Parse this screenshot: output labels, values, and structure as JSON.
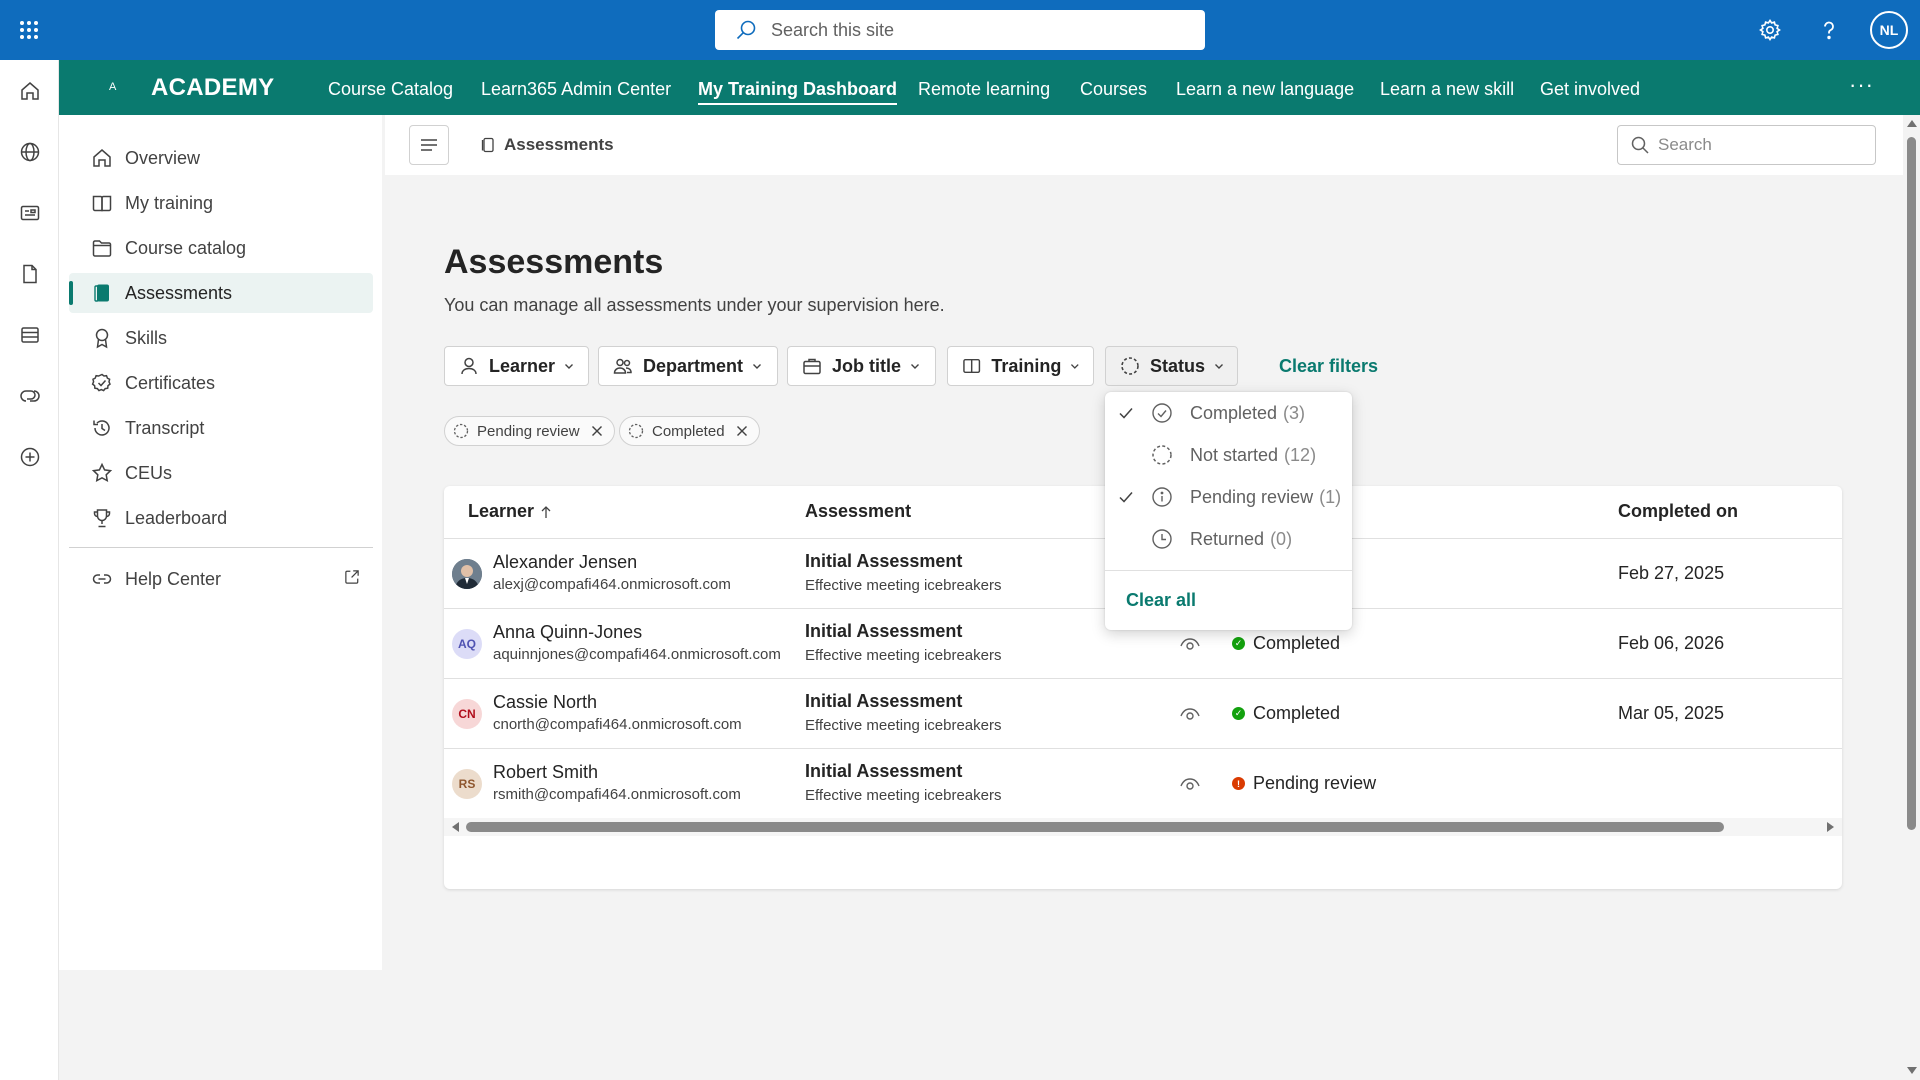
{
  "suite": {
    "search_placeholder": "Search this site",
    "user_initials": "NL"
  },
  "hub": {
    "logo_text": "A",
    "title": "ACADEMY",
    "items": [
      {
        "label": "Course Catalog"
      },
      {
        "label": "Learn365 Admin Center"
      },
      {
        "label": "My Training Dashboard",
        "active": true
      },
      {
        "label": "Remote learning"
      },
      {
        "label": "Courses"
      },
      {
        "label": "Learn a new language"
      },
      {
        "label": "Learn a new skill"
      },
      {
        "label": "Get involved"
      }
    ],
    "more_label": "···"
  },
  "leftnav": {
    "items": [
      {
        "label": "Overview",
        "icon": "home-icon"
      },
      {
        "label": "My training",
        "icon": "book-icon"
      },
      {
        "label": "Course catalog",
        "icon": "folder-icon"
      },
      {
        "label": "Assessments",
        "icon": "notebook-icon",
        "selected": true
      },
      {
        "label": "Skills",
        "icon": "ribbon-icon"
      },
      {
        "label": "Certificates",
        "icon": "certificate-icon"
      },
      {
        "label": "Transcript",
        "icon": "history-icon"
      },
      {
        "label": "CEUs",
        "icon": "star-icon"
      },
      {
        "label": "Leaderboard",
        "icon": "trophy-icon"
      }
    ],
    "help": {
      "label": "Help Center",
      "icon": "link-icon"
    }
  },
  "cmdbar": {
    "breadcrumb": "Assessments",
    "search_placeholder": "Search"
  },
  "page": {
    "title": "Assessments",
    "subtitle": "You can manage all assessments under your supervision here."
  },
  "filters": {
    "buttons": [
      {
        "label": "Learner",
        "icon": "person-icon"
      },
      {
        "label": "Department",
        "icon": "people-icon"
      },
      {
        "label": "Job title",
        "icon": "briefcase-icon"
      },
      {
        "label": "Training",
        "icon": "book-icon"
      },
      {
        "label": "Status",
        "icon": "status-circle-icon"
      }
    ],
    "clear_label": "Clear filters",
    "chips": [
      {
        "label": "Pending review"
      },
      {
        "label": "Completed"
      }
    ]
  },
  "table": {
    "columns": [
      "Learner",
      "Assessment",
      "Completed on"
    ],
    "rows": [
      {
        "initials": "",
        "name": "Alexander Jensen",
        "email": "alexj@compafi464.onmicrosoft.com",
        "assessment": "Initial Assessment",
        "course": "Effective meeting icebreakers",
        "status": "",
        "completed_on": "Feb 27, 2025"
      },
      {
        "initials": "AQ",
        "name": "Anna Quinn-Jones",
        "email": "aquinnjones@compafi464.onmicrosoft.com",
        "assessment": "Initial Assessment",
        "course": "Effective meeting icebreakers",
        "status": "Completed",
        "completed_on": "Feb 06, 2026"
      },
      {
        "initials": "CN",
        "name": "Cassie North",
        "email": "cnorth@compafi464.onmicrosoft.com",
        "assessment": "Initial Assessment",
        "course": "Effective meeting icebreakers",
        "status": "Completed",
        "completed_on": "Mar 05, 2025"
      },
      {
        "initials": "RS",
        "name": "Robert Smith",
        "email": "rsmith@compafi464.onmicrosoft.com",
        "assessment": "Initial Assessment",
        "course": "Effective meeting icebreakers",
        "status": "Pending review",
        "completed_on": ""
      }
    ]
  },
  "status_menu": {
    "options": [
      {
        "label": "Completed",
        "count": "(3)",
        "checked": true
      },
      {
        "label": "Not started",
        "count": "(12)",
        "checked": false
      },
      {
        "label": "Pending review",
        "count": "(1)",
        "checked": true
      },
      {
        "label": "Returned",
        "count": "(0)",
        "checked": false
      }
    ],
    "clear_label": "Clear all"
  },
  "colors": {
    "suite_blue": "#0f6cbd",
    "hub_teal": "#0a7a6f",
    "completed_green": "#13a10e",
    "pending_orange": "#da3b01"
  }
}
